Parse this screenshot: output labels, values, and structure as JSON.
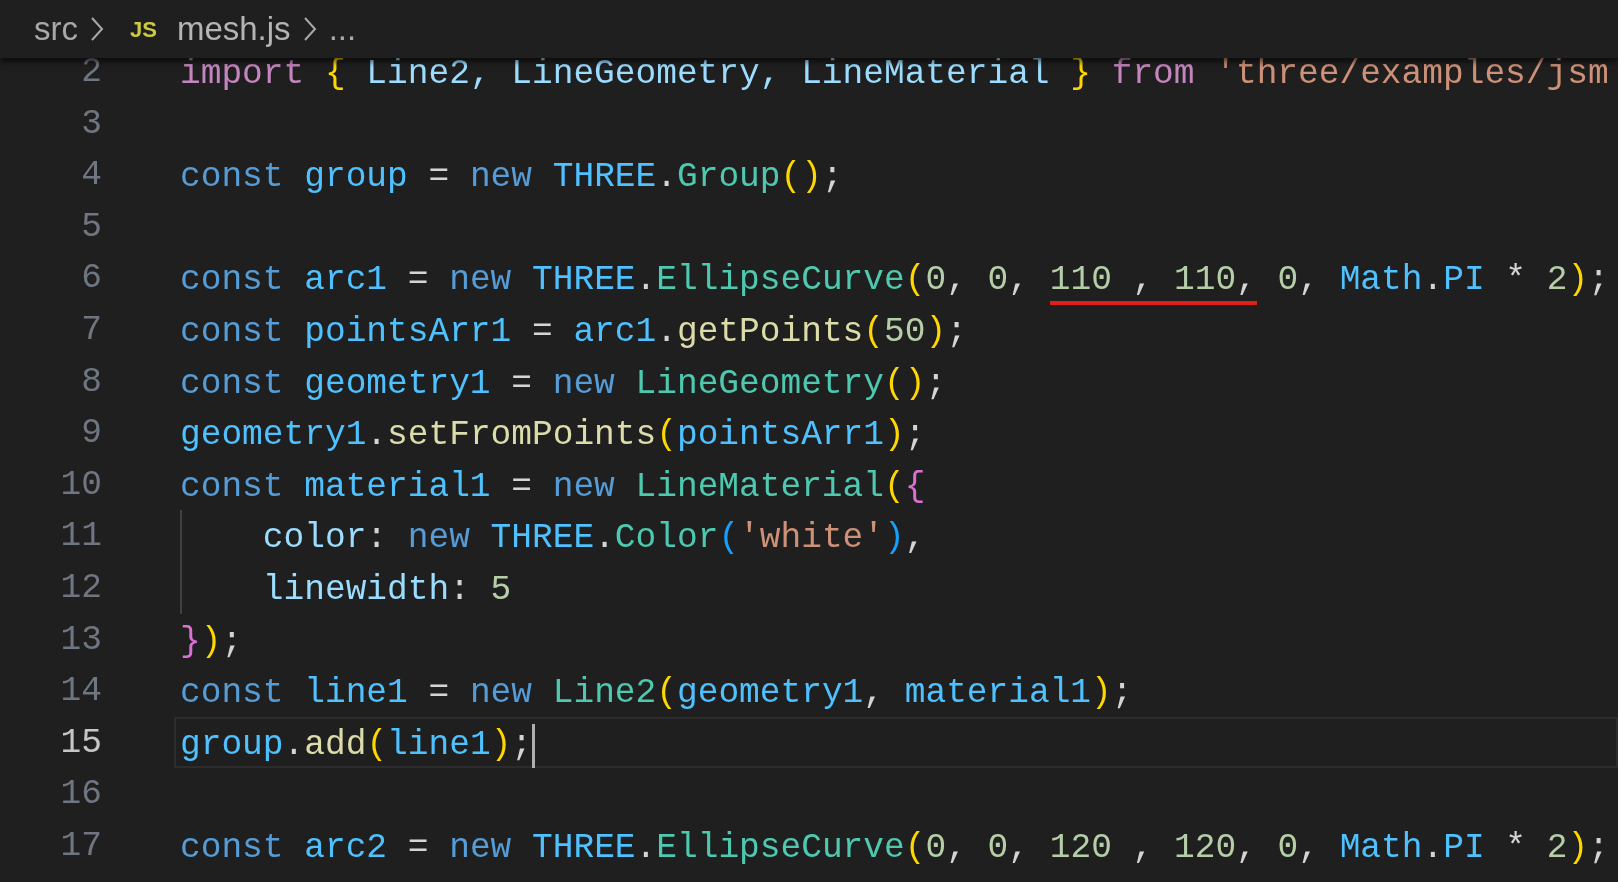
{
  "breadcrumb": [
    {
      "kind": "folder",
      "text": "src"
    },
    {
      "kind": "file",
      "icon_text": "JS",
      "text": "mesh.js"
    },
    {
      "kind": "more",
      "text": "..."
    }
  ],
  "lines": [
    {
      "number": "2",
      "current": false,
      "tokens": [
        {
          "kind": "control",
          "text": "import "
        },
        {
          "kind": "bracket1",
          "text": "{"
        },
        {
          "kind": "prop",
          "text": " Line2, LineGeometry, LineMaterial "
        },
        {
          "kind": "bracket1",
          "text": "} "
        },
        {
          "kind": "control",
          "text": "from "
        },
        {
          "kind": "string",
          "text": "'three/examples/jsm"
        }
      ]
    },
    {
      "number": "3",
      "current": false
    },
    {
      "number": "4",
      "current": false,
      "tokens": [
        {
          "kind": "keyword",
          "text": "const "
        },
        {
          "kind": "var",
          "text": "group "
        },
        {
          "kind": "plain",
          "text": "= "
        },
        {
          "kind": "keyword",
          "text": "new "
        },
        {
          "kind": "var",
          "text": "THREE"
        },
        {
          "kind": "plain",
          "text": "."
        },
        {
          "kind": "class",
          "text": "Group"
        },
        {
          "kind": "bracket1",
          "text": "()"
        },
        {
          "kind": "plain",
          "text": ";"
        }
      ]
    },
    {
      "number": "5",
      "current": false
    },
    {
      "number": "6",
      "current": false,
      "tokens": [
        {
          "kind": "keyword",
          "text": "const "
        },
        {
          "kind": "var",
          "text": "arc1 "
        },
        {
          "kind": "plain",
          "text": "= "
        },
        {
          "kind": "keyword",
          "text": "new "
        },
        {
          "kind": "var",
          "text": "THREE"
        },
        {
          "kind": "plain",
          "text": "."
        },
        {
          "kind": "class",
          "text": "EllipseCurve"
        },
        {
          "kind": "bracket1",
          "text": "("
        },
        {
          "kind": "number",
          "text": "0"
        },
        {
          "kind": "plain",
          "text": ", "
        },
        {
          "kind": "number",
          "text": "0"
        },
        {
          "kind": "plain",
          "text": ", "
        },
        {
          "kind": "number",
          "text": "110",
          "underlined": true
        },
        {
          "kind": "plain",
          "text": " , ",
          "underlined": true
        },
        {
          "kind": "number",
          "text": "110",
          "underlined": true
        },
        {
          "kind": "plain",
          "text": ",",
          "underlined": true
        },
        {
          "kind": "number",
          "text": " 0"
        },
        {
          "kind": "plain",
          "text": ", "
        },
        {
          "kind": "var",
          "text": "Math"
        },
        {
          "kind": "plain",
          "text": "."
        },
        {
          "kind": "var",
          "text": "PI"
        },
        {
          "kind": "plain",
          "text": " * "
        },
        {
          "kind": "number",
          "text": "2"
        },
        {
          "kind": "bracket1",
          "text": ")"
        },
        {
          "kind": "plain",
          "text": ";"
        }
      ]
    },
    {
      "number": "7",
      "current": false,
      "tokens": [
        {
          "kind": "keyword",
          "text": "const "
        },
        {
          "kind": "var",
          "text": "pointsArr1 "
        },
        {
          "kind": "plain",
          "text": "= "
        },
        {
          "kind": "var",
          "text": "arc1"
        },
        {
          "kind": "plain",
          "text": "."
        },
        {
          "kind": "function",
          "text": "getPoints"
        },
        {
          "kind": "bracket1",
          "text": "("
        },
        {
          "kind": "number",
          "text": "50"
        },
        {
          "kind": "bracket1",
          "text": ")"
        },
        {
          "kind": "plain",
          "text": ";"
        }
      ]
    },
    {
      "number": "8",
      "current": false,
      "tokens": [
        {
          "kind": "keyword",
          "text": "const "
        },
        {
          "kind": "var",
          "text": "geometry1 "
        },
        {
          "kind": "plain",
          "text": "= "
        },
        {
          "kind": "keyword",
          "text": "new "
        },
        {
          "kind": "class",
          "text": "LineGeometry"
        },
        {
          "kind": "bracket1",
          "text": "()"
        },
        {
          "kind": "plain",
          "text": ";"
        }
      ]
    },
    {
      "number": "9",
      "current": false,
      "tokens": [
        {
          "kind": "var",
          "text": "geometry1"
        },
        {
          "kind": "plain",
          "text": "."
        },
        {
          "kind": "function",
          "text": "setFromPoints"
        },
        {
          "kind": "bracket1",
          "text": "("
        },
        {
          "kind": "var",
          "text": "pointsArr1"
        },
        {
          "kind": "bracket1",
          "text": ")"
        },
        {
          "kind": "plain",
          "text": ";"
        }
      ]
    },
    {
      "number": "10",
      "current": false,
      "tokens": [
        {
          "kind": "keyword",
          "text": "const "
        },
        {
          "kind": "var",
          "text": "material1 "
        },
        {
          "kind": "plain",
          "text": "= "
        },
        {
          "kind": "keyword",
          "text": "new "
        },
        {
          "kind": "class",
          "text": "LineMaterial"
        },
        {
          "kind": "bracket1",
          "text": "("
        },
        {
          "kind": "bracket2",
          "text": "{"
        }
      ]
    },
    {
      "number": "11",
      "current": false,
      "indent_guide": true,
      "tokens": [
        {
          "kind": "prop",
          "text": "    color"
        },
        {
          "kind": "plain",
          "text": ": "
        },
        {
          "kind": "keyword",
          "text": "new "
        },
        {
          "kind": "var",
          "text": "THREE"
        },
        {
          "kind": "plain",
          "text": "."
        },
        {
          "kind": "class",
          "text": "Color"
        },
        {
          "kind": "bracket3",
          "text": "("
        },
        {
          "kind": "string",
          "text": "'white'"
        },
        {
          "kind": "bracket3",
          "text": ")"
        },
        {
          "kind": "plain",
          "text": ","
        }
      ]
    },
    {
      "number": "12",
      "current": false,
      "indent_guide": true,
      "tokens": [
        {
          "kind": "prop",
          "text": "    linewidth"
        },
        {
          "kind": "plain",
          "text": ": "
        },
        {
          "kind": "number",
          "text": "5"
        }
      ]
    },
    {
      "number": "13",
      "current": false,
      "tokens": [
        {
          "kind": "bracket2",
          "text": "}"
        },
        {
          "kind": "bracket1",
          "text": ")"
        },
        {
          "kind": "plain",
          "text": ";"
        }
      ]
    },
    {
      "number": "14",
      "current": false,
      "tokens": [
        {
          "kind": "keyword",
          "text": "const "
        },
        {
          "kind": "var",
          "text": "line1 "
        },
        {
          "kind": "plain",
          "text": "= "
        },
        {
          "kind": "keyword",
          "text": "new "
        },
        {
          "kind": "class",
          "text": "Line2"
        },
        {
          "kind": "bracket1",
          "text": "("
        },
        {
          "kind": "var",
          "text": "geometry1"
        },
        {
          "kind": "plain",
          "text": ", "
        },
        {
          "kind": "var",
          "text": "material1"
        },
        {
          "kind": "bracket1",
          "text": ")"
        },
        {
          "kind": "plain",
          "text": ";"
        }
      ]
    },
    {
      "number": "15",
      "current": true,
      "tokens": [
        {
          "kind": "var",
          "text": "group"
        },
        {
          "kind": "plain",
          "text": "."
        },
        {
          "kind": "function",
          "text": "add"
        },
        {
          "kind": "bracket1",
          "text": "("
        },
        {
          "kind": "var",
          "text": "line1"
        },
        {
          "kind": "bracket1",
          "text": ")"
        },
        {
          "kind": "plain",
          "text": ";"
        }
      ]
    },
    {
      "number": "16",
      "current": false
    },
    {
      "number": "17",
      "current": false,
      "tokens": [
        {
          "kind": "keyword",
          "text": "const "
        },
        {
          "kind": "var",
          "text": "arc2 "
        },
        {
          "kind": "plain",
          "text": "= "
        },
        {
          "kind": "keyword",
          "text": "new "
        },
        {
          "kind": "var",
          "text": "THREE"
        },
        {
          "kind": "plain",
          "text": "."
        },
        {
          "kind": "class",
          "text": "EllipseCurve"
        },
        {
          "kind": "bracket1",
          "text": "("
        },
        {
          "kind": "number",
          "text": "0"
        },
        {
          "kind": "plain",
          "text": ", "
        },
        {
          "kind": "number",
          "text": "0"
        },
        {
          "kind": "plain",
          "text": ", "
        },
        {
          "kind": "number",
          "text": "120"
        },
        {
          "kind": "plain",
          "text": " , "
        },
        {
          "kind": "number",
          "text": "120"
        },
        {
          "kind": "plain",
          "text": ", "
        },
        {
          "kind": "number",
          "text": "0"
        },
        {
          "kind": "plain",
          "text": ", "
        },
        {
          "kind": "var",
          "text": "Math"
        },
        {
          "kind": "plain",
          "text": "."
        },
        {
          "kind": "var",
          "text": "PI"
        },
        {
          "kind": "plain",
          "text": " * "
        },
        {
          "kind": "number",
          "text": "2"
        },
        {
          "kind": "bracket1",
          "text": ")"
        },
        {
          "kind": "plain",
          "text": ";"
        }
      ]
    }
  ]
}
